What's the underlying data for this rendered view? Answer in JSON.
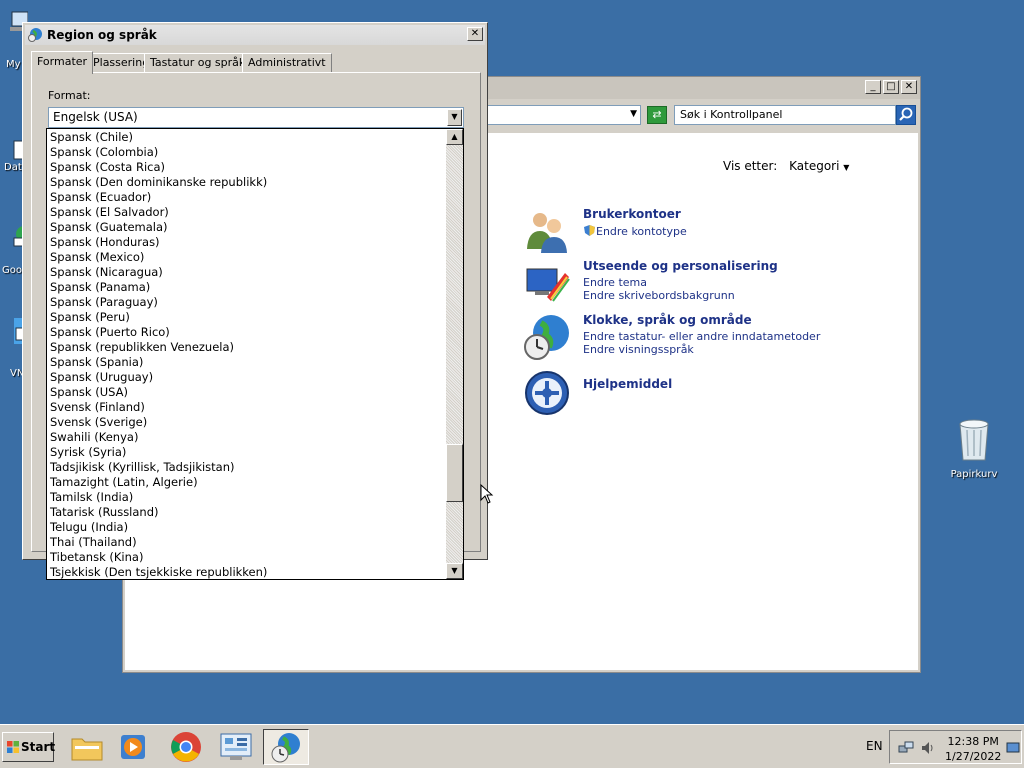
{
  "desktop": {
    "labels": [
      "My",
      "Dat",
      "Goo",
      "VN"
    ],
    "recycle_bin": "Papirkurv"
  },
  "control_panel": {
    "search_placeholder": "Søk i Kontrollpanel",
    "view_by_label": "Vis etter:",
    "view_by_value": "Kategori",
    "categories": [
      {
        "title": "Brukerkontoer",
        "links": [
          "Endre kontotype"
        ]
      },
      {
        "title": "Utseende og personalisering",
        "links": [
          "Endre tema",
          "Endre skrivebordsbakgrunn"
        ]
      },
      {
        "title": "Klokke, språk og område",
        "links": [
          "Endre tastatur- eller andre inndatametoder",
          "Endre visningsspråk"
        ]
      },
      {
        "title": "Hjelpemiddel",
        "links": []
      }
    ]
  },
  "dialog": {
    "title": "Region og språk",
    "tabs": [
      "Formater",
      "Plassering",
      "Tastatur og språk",
      "Administrativt"
    ],
    "format_label": "Format:",
    "format_value": "Engelsk (USA)",
    "options": [
      "Spansk (Chile)",
      "Spansk (Colombia)",
      "Spansk (Costa Rica)",
      "Spansk (Den dominikanske republikk)",
      "Spansk (Ecuador)",
      "Spansk (El Salvador)",
      "Spansk (Guatemala)",
      "Spansk (Honduras)",
      "Spansk (Mexico)",
      "Spansk (Nicaragua)",
      "Spansk (Panama)",
      "Spansk (Paraguay)",
      "Spansk (Peru)",
      "Spansk (Puerto Rico)",
      "Spansk (republikken Venezuela)",
      "Spansk (Spania)",
      "Spansk (Uruguay)",
      "Spansk (USA)",
      "Svensk (Finland)",
      "Svensk (Sverige)",
      "Swahili (Kenya)",
      "Syrisk (Syria)",
      "Tadsjikisk (Kyrillisk, Tadsjikistan)",
      "Tamazight (Latin, Algerie)",
      "Tamilsk (India)",
      "Tatarisk (Russland)",
      "Telugu (India)",
      "Thai (Thailand)",
      "Tibetansk (Kina)",
      "Tsjekkisk (Den tsjekkiske republikken)"
    ],
    "scroll_position": 0.83
  },
  "taskbar": {
    "start_label": "Start",
    "language": "EN",
    "time": "12:38 PM",
    "date": "1/27/2022"
  },
  "colors": {
    "desktop": "#3a6ea5",
    "link": "#1e3287",
    "chrome": "#d4d0c8"
  }
}
